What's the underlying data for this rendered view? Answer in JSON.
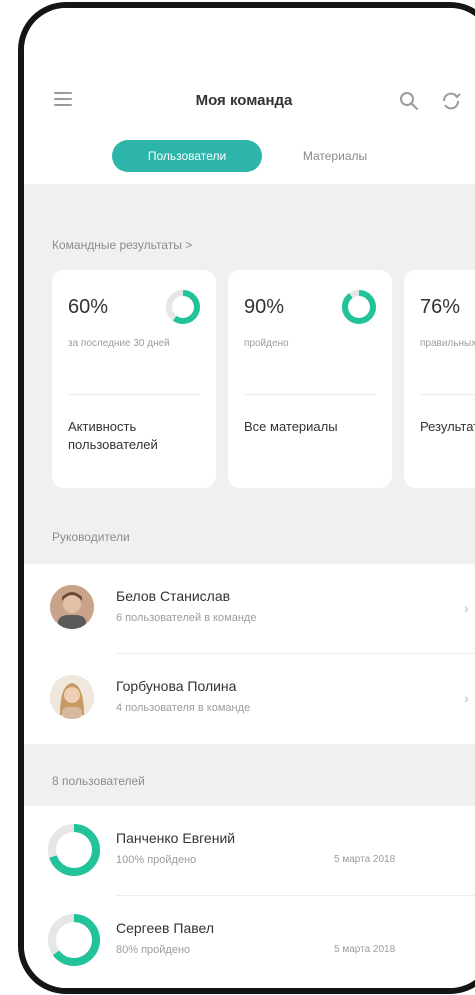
{
  "header": {
    "title": "Моя команда",
    "tabs": [
      {
        "label": "Пользователи",
        "active": true
      },
      {
        "label": "Материалы",
        "active": false
      }
    ]
  },
  "team_results": {
    "title": "Командные результаты >",
    "cards": [
      {
        "percent": "60%",
        "value": 0.6,
        "subtitle": "за последние 30 дней",
        "name": "Активность пользователей"
      },
      {
        "percent": "90%",
        "value": 0.9,
        "subtitle": "пройдено",
        "name": "Все материалы"
      },
      {
        "percent": "76%",
        "value": 0.76,
        "subtitle": "правильных ответов",
        "name": "Результаты тестов"
      }
    ]
  },
  "managers": {
    "title": "Руководители",
    "items": [
      {
        "name": "Белов Станислав",
        "subtitle": "6 пользователей в команде"
      },
      {
        "name": "Горбунова Полина",
        "subtitle": "4 пользователя в команде"
      }
    ]
  },
  "users": {
    "title": "8 пользователей",
    "items": [
      {
        "name": "Панченко Евгений",
        "subtitle": "100% пройдено",
        "date": "5 марта 2018",
        "progress": 0.7
      },
      {
        "name": "Сергеев Павел",
        "subtitle": "80% пройдено",
        "date": "5 марта 2018",
        "progress": 0.65
      }
    ]
  },
  "colors": {
    "accent": "#2cb5a8",
    "ring": "#22c29a",
    "ring_track": "#e6e6e6",
    "background": "#f0f0f0"
  }
}
